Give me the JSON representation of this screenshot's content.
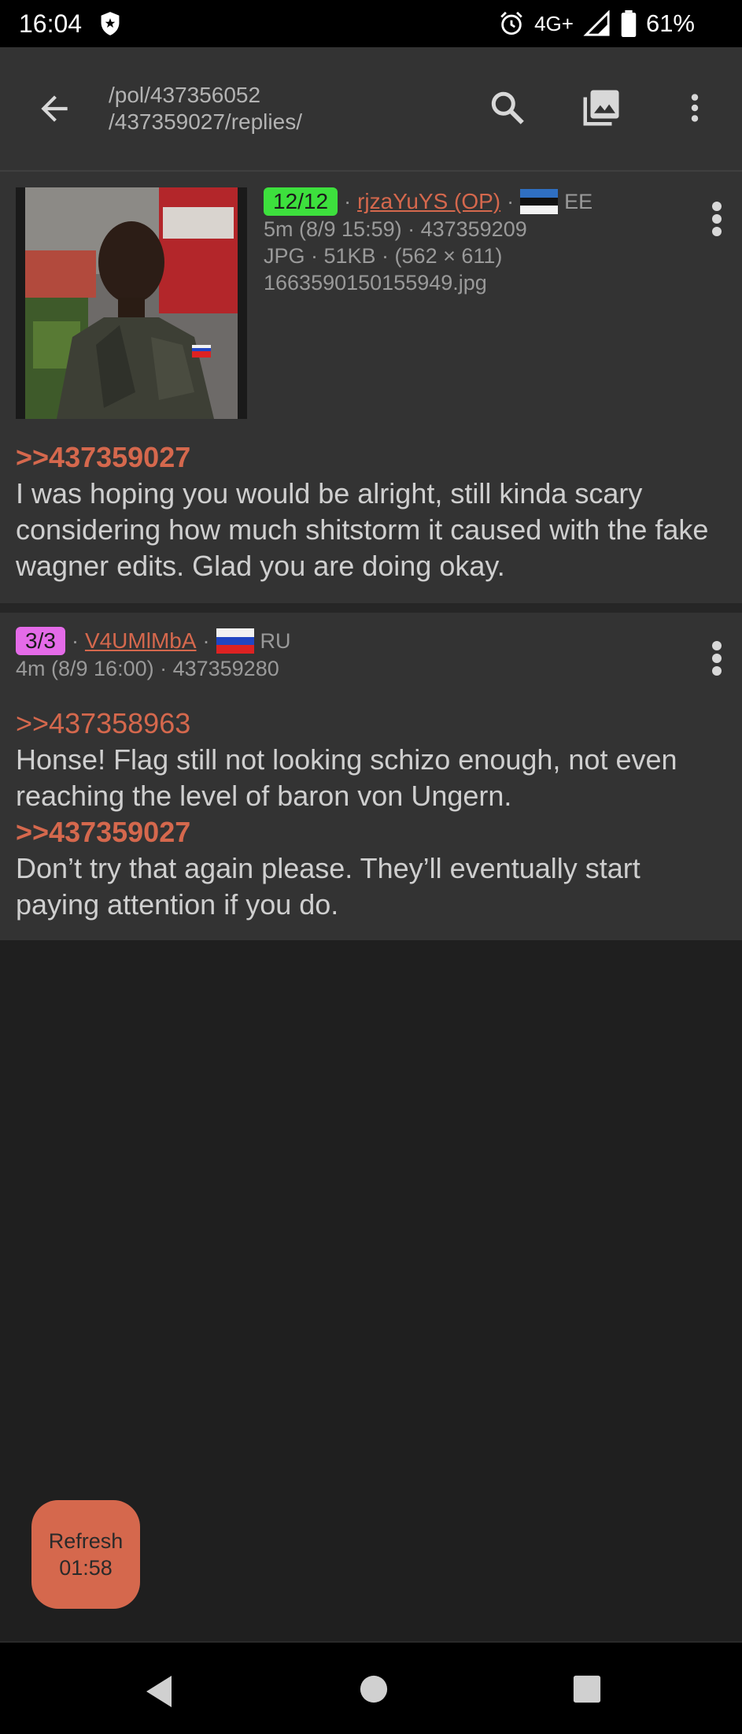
{
  "status_bar": {
    "time": "16:04",
    "network": "4G+",
    "battery": "61%",
    "icons": [
      "shield-icon",
      "alarm-icon",
      "signal-icon",
      "battery-icon"
    ]
  },
  "app_bar": {
    "path_line1": "/pol/437356052",
    "path_line2": "/437359027/replies/",
    "icons": [
      "back-arrow-icon",
      "search-icon",
      "gallery-icon",
      "more-vert-icon"
    ]
  },
  "posts": [
    {
      "badge": "12/12",
      "poster": "rjzaYuYS (OP)",
      "country": "EE",
      "time_line": "5m (8/9 15:59) · 437359209",
      "file_line": "JPG · 51KB · (562 × 611)",
      "filename": "1663590150155949.jpg",
      "quote1": ">>437359027",
      "text1": "I was hoping you would be alright, still kinda scary considering how much shitstorm it caused with the fake wagner edits. Glad you are doing okay."
    },
    {
      "badge": "3/3",
      "poster": "V4UMlMbA",
      "country": "RU",
      "time_line": "4m (8/9 16:00) · 437359280",
      "quote1": ">>437358963",
      "text1": "Honse! Flag still not looking schizo enough, not even reaching the level of baron von Ungern.",
      "quote2": ">>437359027",
      "text2": "Don’t try that again please. They’ll eventually start paying attention if you do."
    }
  ],
  "refresh_button": {
    "label": "Refresh",
    "countdown": "01:58"
  },
  "colors": {
    "accent": "#d5684d",
    "badge_green": "#3de03d",
    "badge_pink": "#e46be8",
    "background": "#1f1f1f",
    "card": "#333333"
  }
}
